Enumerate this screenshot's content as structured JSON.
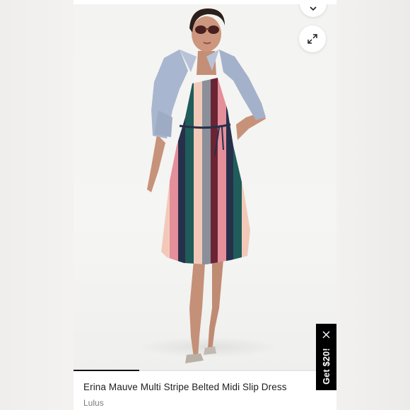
{
  "product": {
    "title": "Erina Mauve Multi Stripe Belted Midi Slip Dress",
    "brand": "Lulus",
    "image_alt": "Model wearing a multi stripe belted midi slip dress with a light blue suede jacket"
  },
  "gallery": {
    "progress": 0.25,
    "collapse_icon": "chevron-down-icon",
    "expand_icon": "expand-arrows-icon"
  },
  "promo": {
    "label": "Get $20!",
    "close_icon": "close-icon"
  },
  "colors": {
    "accent": "#000000",
    "title": "#1d1d1d",
    "muted": "#7a7a7a",
    "stripe_teal": "#1f5c5a",
    "stripe_pink": "#e48f9a",
    "stripe_burgundy": "#6b2434",
    "stripe_blush": "#f2c9b9",
    "stripe_navy": "#27304a",
    "stripe_grey": "#8a8f9a",
    "jacket": "#a9b6cf"
  }
}
